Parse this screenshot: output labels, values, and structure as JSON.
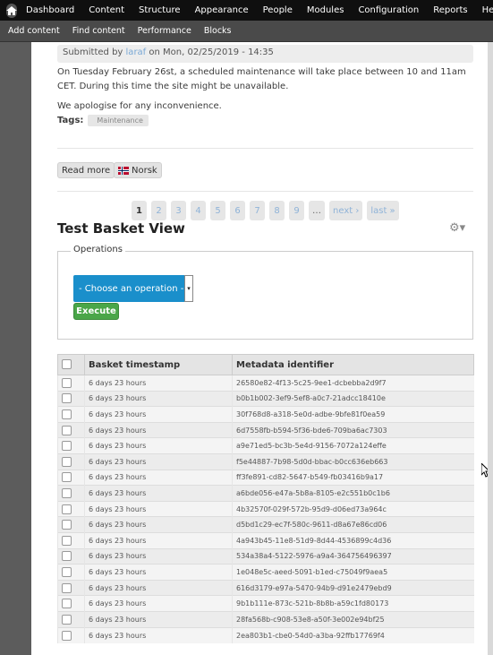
{
  "toolbar": {
    "menu": [
      "Dashboard",
      "Content",
      "Structure",
      "Appearance",
      "People",
      "Modules",
      "Configuration",
      "Reports",
      "Help"
    ],
    "shortcuts": [
      "Add content",
      "Find content",
      "Performance",
      "Blocks"
    ]
  },
  "node": {
    "submitted_prefix": "Submitted by",
    "author": "laraf",
    "submitted_suffix": "on Mon, 02/25/2019 - 14:35",
    "para1": "On Tuesday February 26st, a scheduled maintenance will take place between 10 and 11am CET. During this time the site might be unavailable.",
    "para2": "We apologise for any inconvenience.",
    "tags_label": "Tags:",
    "tag": "Maintenance",
    "read_more": "Read more",
    "language_link": "Norsk"
  },
  "pager": [
    "1",
    "2",
    "3",
    "4",
    "5",
    "6",
    "7",
    "8",
    "9",
    "…",
    "next ›",
    "last »"
  ],
  "view": {
    "title": "Test Basket View",
    "operations_legend": "Operations",
    "select_value": "- Choose an operation -",
    "execute": "Execute",
    "columns": [
      "Basket timestamp",
      "Metadata identifier"
    ],
    "rows": [
      {
        "timestamp": "6 days 23 hours",
        "id": "26580e82-4f13-5c25-9ee1-dcbebba2d9f7"
      },
      {
        "timestamp": "6 days 23 hours",
        "id": "b0b1b002-3ef9-5ef8-a0c7-21adcc18410e"
      },
      {
        "timestamp": "6 days 23 hours",
        "id": "30f768d8-a318-5e0d-adbe-9bfe81f0ea59"
      },
      {
        "timestamp": "6 days 23 hours",
        "id": "6d7558fb-b594-5f36-bde6-709ba6ac7303"
      },
      {
        "timestamp": "6 days 23 hours",
        "id": "a9e71ed5-bc3b-5e4d-9156-7072a124effe"
      },
      {
        "timestamp": "6 days 23 hours",
        "id": "f5e44887-7b98-5d0d-bbac-b0cc636eb663"
      },
      {
        "timestamp": "6 days 23 hours",
        "id": "ff3fe891-cd82-5647-b549-fb03416b9a17"
      },
      {
        "timestamp": "6 days 23 hours",
        "id": "a6bde056-e47a-5b8a-8105-e2c551b0c1b6"
      },
      {
        "timestamp": "6 days 23 hours",
        "id": "4b32570f-029f-572b-95d9-d06ed73a964c"
      },
      {
        "timestamp": "6 days 23 hours",
        "id": "d5bd1c29-ec7f-580c-9611-d8a67e86cd06"
      },
      {
        "timestamp": "6 days 23 hours",
        "id": "4a943b45-11e8-51d9-8d44-4536899c4d36"
      },
      {
        "timestamp": "6 days 23 hours",
        "id": "534a38a4-5122-5976-a9a4-364756496397"
      },
      {
        "timestamp": "6 days 23 hours",
        "id": "1e048e5c-aeed-5091-b1ed-c75049f9aea5"
      },
      {
        "timestamp": "6 days 23 hours",
        "id": "616d3179-e97a-5470-94b9-d91e2479ebd9"
      },
      {
        "timestamp": "6 days 23 hours",
        "id": "9b1b111e-873c-521b-8b8b-a59c1fd80173"
      },
      {
        "timestamp": "6 days 23 hours",
        "id": "28fa568b-c908-53e8-a50f-3e002e94bf25"
      },
      {
        "timestamp": "6 days 23 hours",
        "id": "2ea803b1-cbe0-54d0-a3ba-92ffb17769f4"
      }
    ]
  }
}
